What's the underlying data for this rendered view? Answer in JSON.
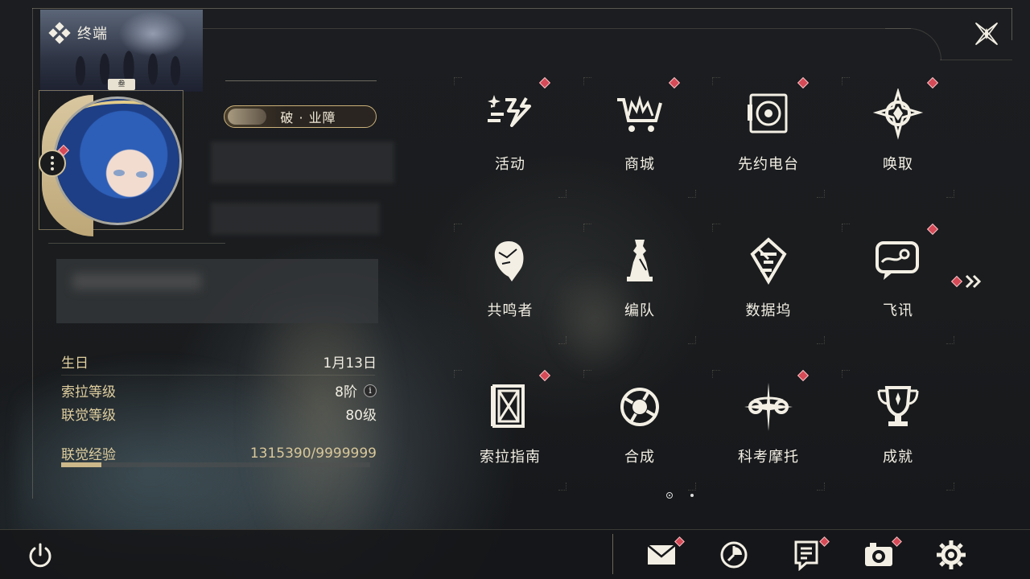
{
  "header": {
    "title": "终端"
  },
  "profile": {
    "rank_tag": "叁",
    "title_badge": "破 · 业障"
  },
  "stats": [
    {
      "label": "生日",
      "value": "1月13日"
    },
    {
      "label": "索拉等级",
      "value": "8阶"
    },
    {
      "label": "联觉等级",
      "value": "80级"
    },
    {
      "label": "联觉经验",
      "value": "1315390/9999999"
    }
  ],
  "exp_progress": 0.1315,
  "menu": [
    {
      "label": "活动",
      "icon": "event-sparkle-icon",
      "badge": true
    },
    {
      "label": "商城",
      "icon": "shop-cart-icon",
      "badge": true
    },
    {
      "label": "先约电台",
      "icon": "radio-icon",
      "badge": true
    },
    {
      "label": "唤取",
      "icon": "summon-compass-icon",
      "badge": true
    },
    {
      "label": "共鸣者",
      "icon": "resonator-head-icon",
      "badge": false
    },
    {
      "label": "编队",
      "icon": "team-chess-icon",
      "badge": false
    },
    {
      "label": "数据坞",
      "icon": "data-dock-icon",
      "badge": false
    },
    {
      "label": "飞讯",
      "icon": "message-chat-icon",
      "badge": true
    },
    {
      "label": "索拉指南",
      "icon": "guide-book-icon",
      "badge": true
    },
    {
      "label": "合成",
      "icon": "synthesis-icon",
      "badge": false
    },
    {
      "label": "科考摩托",
      "icon": "motorbike-icon",
      "badge": true
    },
    {
      "label": "成就",
      "icon": "trophy-icon",
      "badge": false
    }
  ],
  "bottom_bar": [
    {
      "icon": "mail-icon",
      "badge": true
    },
    {
      "icon": "clock-icon",
      "badge": false
    },
    {
      "icon": "notice-icon",
      "badge": true
    },
    {
      "icon": "camera-icon",
      "badge": true
    },
    {
      "icon": "settings-gear-icon",
      "badge": false
    }
  ],
  "colors": {
    "accent_gold": "#e0cf9f",
    "badge_red": "#d54a56",
    "text": "#f3efe4"
  }
}
